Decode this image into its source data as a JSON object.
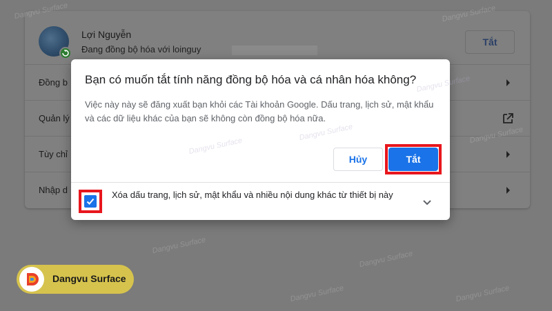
{
  "background": {
    "profile": {
      "name": "Lợi Nguyễn",
      "status": "Đang đồng bộ hóa với loinguy",
      "turn_off_label": "Tắt"
    },
    "rows": [
      {
        "label": "Đồng b",
        "icon": "chevron-right-icon"
      },
      {
        "label": "Quản lý",
        "icon": "open-external-icon"
      },
      {
        "label": "Tùy chỉ",
        "icon": "chevron-right-icon"
      },
      {
        "label": "Nhập d",
        "icon": "chevron-right-icon"
      }
    ]
  },
  "dialog": {
    "title": "Bạn có muốn tắt tính năng đồng bộ hóa và cá nhân hóa không?",
    "body": "Việc này này sẽ đăng xuất bạn khỏi các Tài khoản Google. Dấu trang, lịch sử, mật khẩu và các dữ liệu khác của bạn sẽ không còn đồng bộ hóa nữa.",
    "cancel_label": "Hủy",
    "confirm_label": "Tắt",
    "checkbox_label": "Xóa dấu trang, lịch sử, mật khẩu và nhiều nội dung khác từ thiết bị này",
    "checkbox_checked": true
  },
  "watermark": {
    "text": "Dangvu Surface",
    "brand_label": "Dangvu Surface"
  },
  "colors": {
    "primary": "#1a73e8",
    "highlight": "#e8161d",
    "brand": "#d6c34d"
  }
}
